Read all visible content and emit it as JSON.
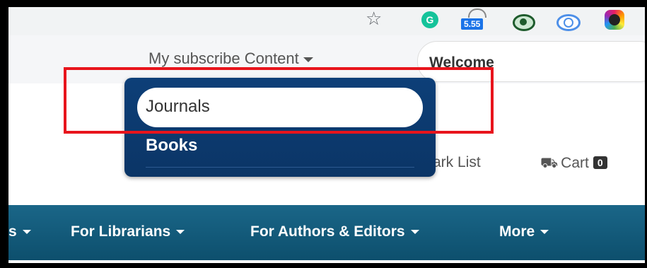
{
  "browser": {
    "extensions": {
      "grammarly": "G",
      "speed_value": "5.55"
    }
  },
  "header": {
    "subscribe_menu": "My subscribe Content",
    "welcome": "Welcome"
  },
  "secondary": {
    "mark_list": "ark List",
    "cart_label": "Cart",
    "cart_count": "0"
  },
  "dropdown": {
    "items": [
      {
        "label": "Journals"
      },
      {
        "label": "Books"
      }
    ]
  },
  "nav": {
    "items": [
      {
        "label": "s"
      },
      {
        "label": "For Librarians"
      },
      {
        "label": "For Authors & Editors"
      },
      {
        "label": "More"
      }
    ]
  },
  "colors": {
    "highlight": "#e8141c",
    "navbar": "#1a6688",
    "dropdown": "#0d3f78"
  }
}
